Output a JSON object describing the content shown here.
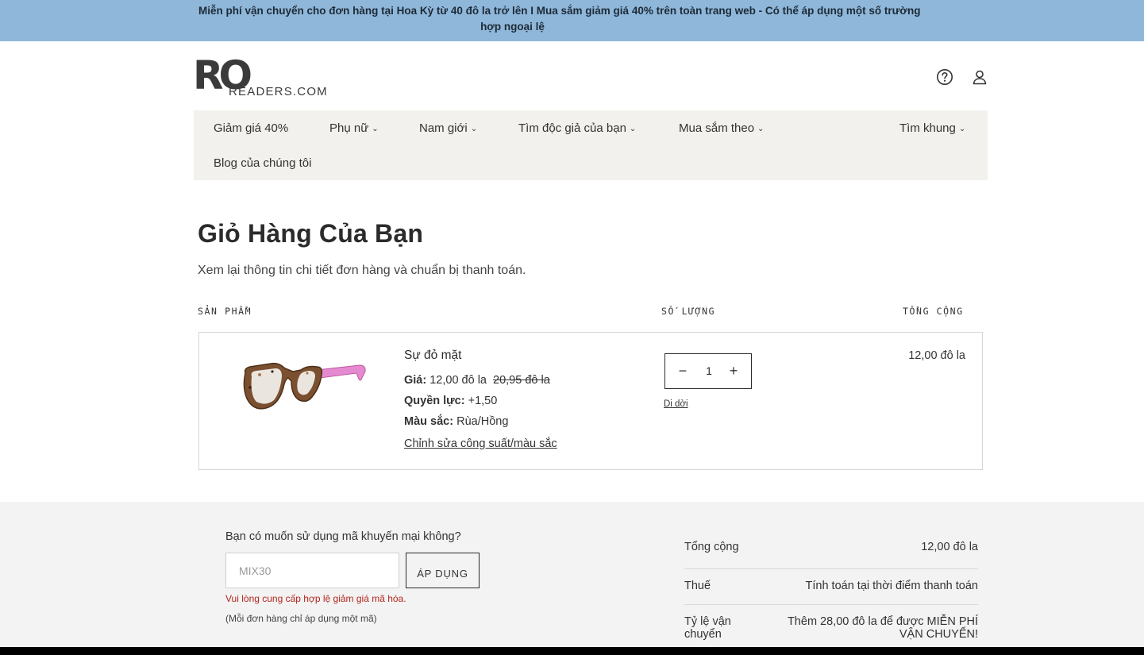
{
  "announcement": {
    "line1": "Miễn phí vận chuyển cho đơn hàng tại Hoa Kỳ từ 40 đô la trở lên I Mua sắm giảm giá 40% trên toàn trang web - Có thể áp dụng một số trường",
    "line2": "hợp ngoại lệ"
  },
  "brand": {
    "mark": "RO",
    "wordmark": "READERS.COM"
  },
  "header_icons": [
    "help-icon",
    "account-icon"
  ],
  "nav": {
    "items": [
      {
        "label": "Giảm giá 40%",
        "has_dropdown": false
      },
      {
        "label": "Phụ nữ",
        "has_dropdown": true
      },
      {
        "label": "Nam giới",
        "has_dropdown": true
      },
      {
        "label": "Tìm độc giả của bạn",
        "has_dropdown": true
      },
      {
        "label": "Mua sắm theo",
        "has_dropdown": true
      },
      {
        "label": "Tìm khung",
        "has_dropdown": true
      },
      {
        "label": "Blog của chúng tôi",
        "has_dropdown": false
      }
    ],
    "chevron": "⌄"
  },
  "page": {
    "title": "Giỏ Hàng Của Bạn",
    "subtitle": "Xem lại thông tin chi tiết đơn hàng và chuẩn bị thanh toán."
  },
  "columns": {
    "product": "SẢN PHẨM",
    "quantity": "SỐ LƯỢNG",
    "total": "TỔNG CỘNG"
  },
  "cart_item": {
    "name": "Sự đỏ mặt",
    "price_label": "Giá:",
    "price": "12,00 đô la",
    "old_price": "20,95 đô la",
    "power_label": "Quyền lực:",
    "power": "+1,50",
    "color_label": "Màu sắc:",
    "color": "Rùa/Hồng",
    "edit_label": "Chỉnh sửa công suất/màu sắc",
    "quantity": "1",
    "minus": "−",
    "plus": "+",
    "remove_label": "Di dời",
    "line_total": "12,00 đô la"
  },
  "promo": {
    "question": "Bạn có muốn sử dụng mã khuyến mại không?",
    "input_value": "MIX30",
    "button_label": "ÁP DỤNG",
    "error": "Vui lòng cung cấp hợp lệ giảm giá mã hóa.",
    "note": "(Mỗi đơn hàng chỉ áp dụng một mã)"
  },
  "summary": {
    "subtotal_label": "Tổng cộng",
    "subtotal_value": "12,00 đô la",
    "tax_label": "Thuế",
    "tax_value": "Tính toán tại thời điểm thanh toán",
    "shipping_label_1": "Tỷ lệ vận",
    "shipping_label_2": "chuyển",
    "shipping_value_1": "Thêm 28,00 đô la để được MIỄN PHÍ",
    "shipping_value_2": "VẬN CHUYỂN!"
  },
  "colors": {
    "announcement_bg": "#8fb7da",
    "nav_bg": "#f3f1ed",
    "error": "#b3261e",
    "frame_pink": "#e58ad0",
    "frame_tortoise": "#7a5030"
  }
}
